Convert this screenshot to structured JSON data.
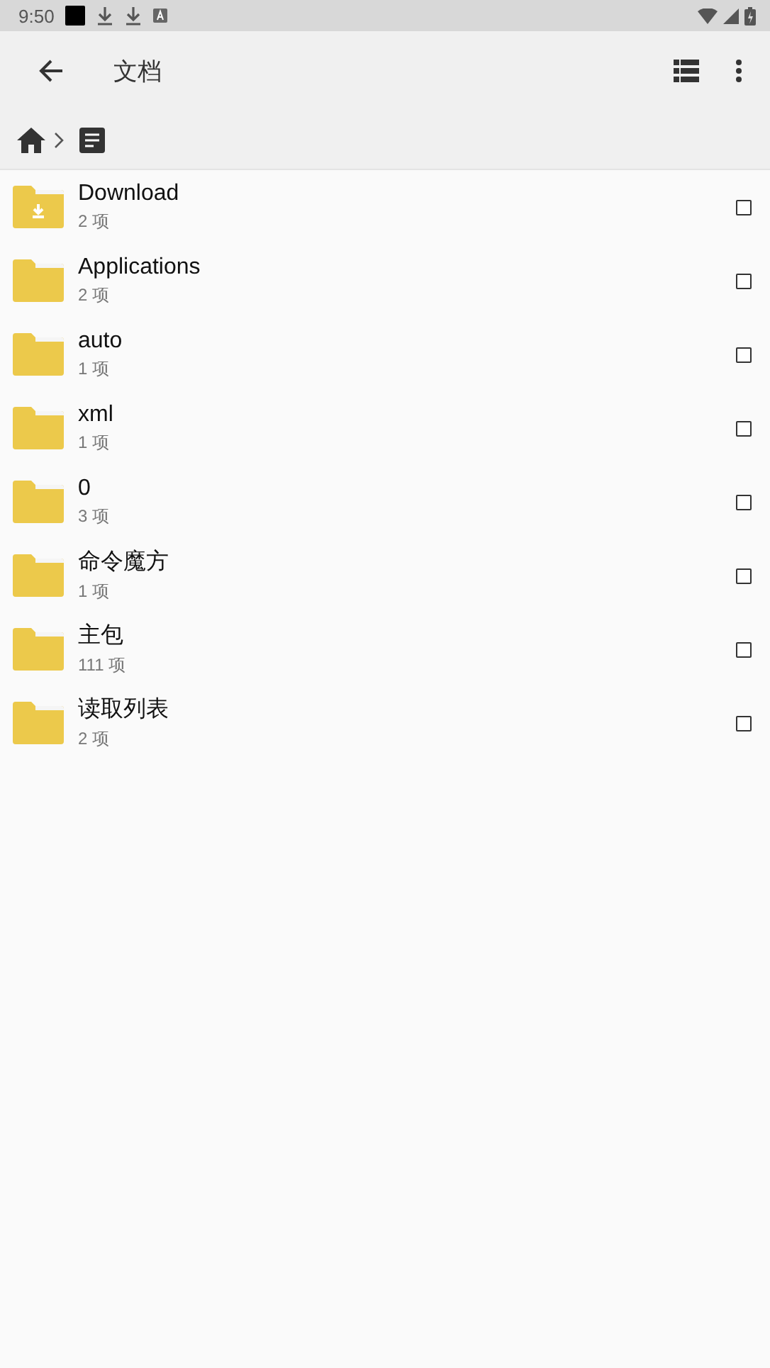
{
  "status_bar": {
    "time": "9:50"
  },
  "app_bar": {
    "title": "文档"
  },
  "items": [
    {
      "name": "Download",
      "count": "2 项",
      "kind": "download",
      "checked": false
    },
    {
      "name": "Applications",
      "count": "2 项",
      "kind": "folder",
      "checked": false
    },
    {
      "name": "auto",
      "count": "1 项",
      "kind": "folder",
      "checked": false
    },
    {
      "name": "xml",
      "count": "1 项",
      "kind": "folder",
      "checked": false
    },
    {
      "name": "0",
      "count": "3 项",
      "kind": "folder",
      "checked": false
    },
    {
      "name": "命令魔方",
      "count": "1 项",
      "kind": "folder",
      "checked": false
    },
    {
      "name": "主包",
      "count": "111 项",
      "kind": "folder",
      "checked": false
    },
    {
      "name": "读取列表",
      "count": "2 项",
      "kind": "folder",
      "checked": false
    }
  ]
}
